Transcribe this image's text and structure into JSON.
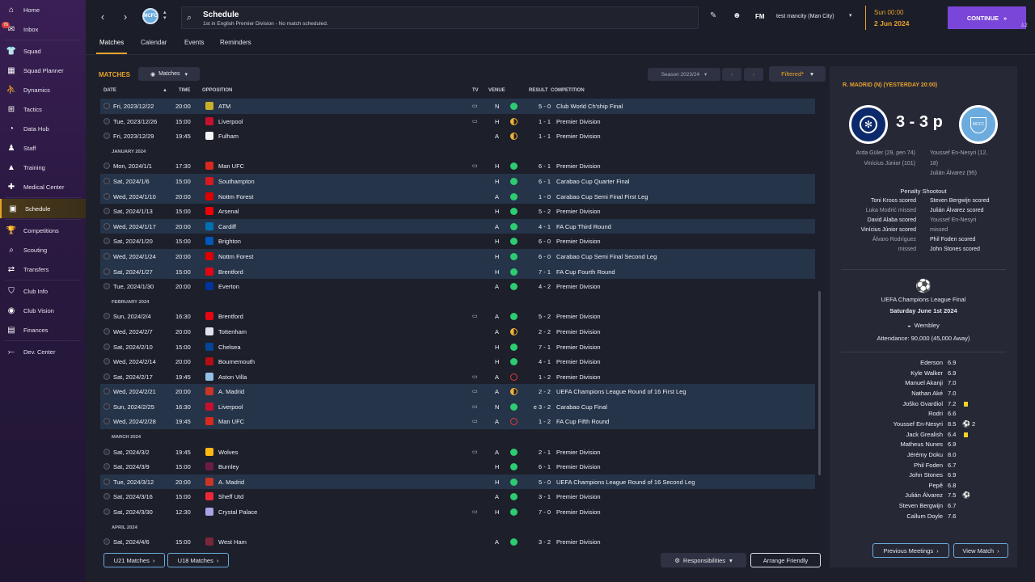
{
  "sidebar": {
    "inbox_badge": "76",
    "items": [
      {
        "label": "Home",
        "icon": "home-icon"
      },
      {
        "label": "Inbox",
        "icon": "inbox-icon"
      },
      {
        "label": "Squad",
        "icon": "shirt-icon"
      },
      {
        "label": "Squad Planner",
        "icon": "planner-icon"
      },
      {
        "label": "Dynamics",
        "icon": "dynamics-icon"
      },
      {
        "label": "Tactics",
        "icon": "tactics-icon"
      },
      {
        "label": "Data Hub",
        "icon": "datahub-icon"
      },
      {
        "label": "Staff",
        "icon": "staff-icon"
      },
      {
        "label": "Training",
        "icon": "training-icon"
      },
      {
        "label": "Medical Center",
        "icon": "medical-icon"
      },
      {
        "label": "Schedule",
        "icon": "calendar-icon"
      },
      {
        "label": "Competitions",
        "icon": "trophy-icon"
      },
      {
        "label": "Scouting",
        "icon": "scouting-icon"
      },
      {
        "label": "Transfers",
        "icon": "transfers-icon"
      },
      {
        "label": "Club Info",
        "icon": "shield-icon"
      },
      {
        "label": "Club Vision",
        "icon": "vision-icon"
      },
      {
        "label": "Finances",
        "icon": "finances-icon"
      },
      {
        "label": "Dev. Center",
        "icon": "dev-center-icon"
      }
    ]
  },
  "header": {
    "title": "Schedule",
    "subtitle": "1st in English Premier Division - No match scheduled.",
    "fm_label": "FM",
    "manager": "test mancity (Man City)",
    "time": "Sun 00:00",
    "date": "2 Jun 2024",
    "continue": "CONTINUE",
    "user_count": "2",
    "club_crest_text": "MCFC"
  },
  "tabs": [
    "Matches",
    "Calendar",
    "Events",
    "Reminders"
  ],
  "matches": {
    "title": "MATCHES",
    "view_dropdown": "Matches",
    "season": "Season 2023/24",
    "filter": "Filtered*",
    "columns": {
      "date": "DATE",
      "time": "TIME",
      "opposition": "OPPOSITION",
      "tv": "TV",
      "venue": "VENUE",
      "result": "RESULT",
      "competition": "COMPETITION"
    },
    "rows": [
      {
        "type": "match",
        "date": "Fri, 2023/12/22",
        "time": "20:00",
        "opp": "ATM",
        "tv": true,
        "venue": "N",
        "result": "5 - 0",
        "comp": "Club World Ch'ship Final",
        "outcome": "win",
        "crest": "#c8b02a",
        "hl": true
      },
      {
        "type": "match",
        "date": "Tue, 2023/12/26",
        "time": "15:00",
        "opp": "Liverpool",
        "tv": true,
        "venue": "H",
        "result": "1 - 1",
        "comp": "Premier Division",
        "outcome": "draw",
        "crest": "#c8102e",
        "hl": false
      },
      {
        "type": "match",
        "date": "Fri, 2023/12/29",
        "time": "19:45",
        "opp": "Fulham",
        "tv": false,
        "venue": "A",
        "result": "1 - 1",
        "comp": "Premier Division",
        "outcome": "draw",
        "crest": "#f4f4f4",
        "hl": false
      },
      {
        "type": "section",
        "label": "JANUARY 2024"
      },
      {
        "type": "match",
        "date": "Mon, 2024/1/1",
        "time": "17:30",
        "opp": "Man UFC",
        "tv": true,
        "venue": "H",
        "result": "6 - 1",
        "comp": "Premier Division",
        "outcome": "win",
        "crest": "#da291c",
        "hl": false
      },
      {
        "type": "match",
        "date": "Sat, 2024/1/6",
        "time": "15:00",
        "opp": "Southampton",
        "tv": false,
        "venue": "H",
        "result": "6 - 1",
        "comp": "Carabao Cup Quarter Final",
        "outcome": "win",
        "crest": "#d71920",
        "hl": true
      },
      {
        "type": "match",
        "date": "Wed, 2024/1/10",
        "time": "20:00",
        "opp": "Nottm Forest",
        "tv": false,
        "venue": "A",
        "result": "1 - 0",
        "comp": "Carabao Cup Semi Final First Leg",
        "outcome": "win",
        "crest": "#dd0000",
        "hl": true
      },
      {
        "type": "match",
        "date": "Sat, 2024/1/13",
        "time": "15:00",
        "opp": "Arsenal",
        "tv": false,
        "venue": "H",
        "result": "5 - 2",
        "comp": "Premier Division",
        "outcome": "win",
        "crest": "#ef0107",
        "hl": false
      },
      {
        "type": "match",
        "date": "Wed, 2024/1/17",
        "time": "20:00",
        "opp": "Cardiff",
        "tv": false,
        "venue": "A",
        "result": "4 - 1",
        "comp": "FA Cup Third Round",
        "outcome": "win",
        "crest": "#0070b5",
        "hl": true
      },
      {
        "type": "match",
        "date": "Sat, 2024/1/20",
        "time": "15:00",
        "opp": "Brighton",
        "tv": false,
        "venue": "H",
        "result": "6 - 0",
        "comp": "Premier Division",
        "outcome": "win",
        "crest": "#0057b8",
        "hl": false
      },
      {
        "type": "match",
        "date": "Wed, 2024/1/24",
        "time": "20:00",
        "opp": "Nottm Forest",
        "tv": false,
        "venue": "H",
        "result": "6 - 0",
        "comp": "Carabao Cup Semi Final Second Leg",
        "outcome": "win",
        "crest": "#dd0000",
        "hl": true
      },
      {
        "type": "match",
        "date": "Sat, 2024/1/27",
        "time": "15:00",
        "opp": "Brentford",
        "tv": false,
        "venue": "H",
        "result": "7 - 1",
        "comp": "FA Cup Fourth Round",
        "outcome": "win",
        "crest": "#e30613",
        "hl": true
      },
      {
        "type": "match",
        "date": "Tue, 2024/1/30",
        "time": "20:00",
        "opp": "Everton",
        "tv": false,
        "venue": "A",
        "result": "4 - 2",
        "comp": "Premier Division",
        "outcome": "win",
        "crest": "#003399",
        "hl": false
      },
      {
        "type": "section",
        "label": "FEBRUARY 2024"
      },
      {
        "type": "match",
        "date": "Sun, 2024/2/4",
        "time": "16:30",
        "opp": "Brentford",
        "tv": true,
        "venue": "A",
        "result": "5 - 2",
        "comp": "Premier Division",
        "outcome": "win",
        "crest": "#e30613",
        "hl": false
      },
      {
        "type": "match",
        "date": "Wed, 2024/2/7",
        "time": "20:00",
        "opp": "Tottenham",
        "tv": false,
        "venue": "A",
        "result": "2 - 2",
        "comp": "Premier Division",
        "outcome": "draw",
        "crest": "#dfe3ee",
        "hl": false
      },
      {
        "type": "match",
        "date": "Sat, 2024/2/10",
        "time": "15:00",
        "opp": "Chelsea",
        "tv": false,
        "venue": "H",
        "result": "7 - 1",
        "comp": "Premier Division",
        "outcome": "win",
        "crest": "#034694",
        "hl": false
      },
      {
        "type": "match",
        "date": "Wed, 2024/2/14",
        "time": "20:00",
        "opp": "Bournemouth",
        "tv": false,
        "venue": "H",
        "result": "4 - 1",
        "comp": "Premier Division",
        "outcome": "win",
        "crest": "#b50e12",
        "hl": false
      },
      {
        "type": "match",
        "date": "Sat, 2024/2/17",
        "time": "19:45",
        "opp": "Aston Villa",
        "tv": true,
        "venue": "A",
        "result": "1 - 2",
        "comp": "Premier Division",
        "outcome": "loss",
        "crest": "#95bfe5",
        "hl": false
      },
      {
        "type": "match",
        "date": "Wed, 2024/2/21",
        "time": "20:00",
        "opp": "A. Madrid",
        "tv": true,
        "venue": "A",
        "result": "2 - 2",
        "comp": "UEFA Champions League Round of 16 First Leg",
        "outcome": "draw",
        "crest": "#cb3524",
        "hl": true
      },
      {
        "type": "match",
        "date": "Sun, 2024/2/25",
        "time": "16:30",
        "opp": "Liverpool",
        "tv": true,
        "venue": "N",
        "result": "e 3 - 2",
        "comp": "Carabao Cup Final",
        "outcome": "win",
        "crest": "#c8102e",
        "hl": true
      },
      {
        "type": "match",
        "date": "Wed, 2024/2/28",
        "time": "19:45",
        "opp": "Man UFC",
        "tv": true,
        "venue": "A",
        "result": "1 - 2",
        "comp": "FA Cup Fifth Round",
        "outcome": "loss",
        "crest": "#da291c",
        "hl": true
      },
      {
        "type": "section",
        "label": "MARCH 2024"
      },
      {
        "type": "match",
        "date": "Sat, 2024/3/2",
        "time": "19:45",
        "opp": "Wolves",
        "tv": true,
        "venue": "A",
        "result": "2 - 1",
        "comp": "Premier Division",
        "outcome": "win",
        "crest": "#fdb913",
        "hl": false
      },
      {
        "type": "match",
        "date": "Sat, 2024/3/9",
        "time": "15:00",
        "opp": "Burnley",
        "tv": false,
        "venue": "H",
        "result": "6 - 1",
        "comp": "Premier Division",
        "outcome": "win",
        "crest": "#6c1d45",
        "hl": false
      },
      {
        "type": "match",
        "date": "Tue, 2024/3/12",
        "time": "20:00",
        "opp": "A. Madrid",
        "tv": false,
        "venue": "H",
        "result": "5 - 0",
        "comp": "UEFA Champions League Round of 16 Second Leg",
        "outcome": "win",
        "crest": "#cb3524",
        "hl": true
      },
      {
        "type": "match",
        "date": "Sat, 2024/3/16",
        "time": "15:00",
        "opp": "Sheff Utd",
        "tv": false,
        "venue": "A",
        "result": "3 - 1",
        "comp": "Premier Division",
        "outcome": "win",
        "crest": "#ee2737",
        "hl": false
      },
      {
        "type": "match",
        "date": "Sat, 2024/3/30",
        "time": "12:30",
        "opp": "Crystal Palace",
        "tv": true,
        "venue": "H",
        "result": "7 - 0",
        "comp": "Premier Division",
        "outcome": "win",
        "crest": "#a7a5e6",
        "hl": false
      },
      {
        "type": "section",
        "label": "APRIL 2024"
      },
      {
        "type": "match",
        "date": "Sat, 2024/4/6",
        "time": "15:00",
        "opp": "West Ham",
        "tv": false,
        "venue": "A",
        "result": "3 - 2",
        "comp": "Premier Division",
        "outcome": "win",
        "crest": "#7a263a",
        "hl": false
      }
    ],
    "footer": {
      "u21": "U21 Matches",
      "u18": "U18 Matches",
      "responsibilities": "Responsibilities",
      "arrange": "Arrange Friendly"
    }
  },
  "match_panel": {
    "title": "R. MADRID (N) (YESTERDAY 20:00)",
    "score": "3 - 3 p",
    "home_scorers": [
      "Arda Güler (29, pen 74)",
      "Vinícius Júnior (101)"
    ],
    "away_scorers": [
      "Youssef En-Nesyri (12,",
      "18)",
      "Julián Álvarez (95)"
    ],
    "penalty_title": "Penalty Shootout",
    "penalties_home": [
      [
        "Toni Kroos scored",
        "w"
      ],
      [
        "Luka Modrić missed",
        "m"
      ],
      [
        "David Alaba scored",
        "w"
      ],
      [
        "Vinícius Júnior scored",
        "w"
      ],
      [
        "Álvaro Rodríguez",
        "m"
      ],
      [
        "missed",
        "m"
      ]
    ],
    "penalties_away": [
      [
        "Steven Bergwijn scored",
        "w"
      ],
      [
        "Julián Álvarez scored",
        "w"
      ],
      [
        "Youssef En-Nesyri",
        "m"
      ],
      [
        "missed",
        "m"
      ],
      [
        "Phil Foden scored",
        "w"
      ],
      [
        "John Stones scored",
        "w"
      ]
    ],
    "competition": "UEFA Champions League Final",
    "date": "Saturday June 1st 2024",
    "venue": "Wembley",
    "attendance": "Attendance: 90,000 (45,000 Away)",
    "players": [
      {
        "name": "Ederson",
        "rating": "6.9",
        "mark": ""
      },
      {
        "name": "Kyle Walker",
        "rating": "6.9",
        "mark": ""
      },
      {
        "name": "Manuel Akanji",
        "rating": "7.0",
        "mark": ""
      },
      {
        "name": "Nathan Aké",
        "rating": "7.0",
        "mark": ""
      },
      {
        "name": "Joško Gvardiol",
        "rating": "7.2",
        "mark": "yellow"
      },
      {
        "name": "Rodri",
        "rating": "6.6",
        "mark": ""
      },
      {
        "name": "Youssef En-Nesyri",
        "rating": "8.5",
        "mark": "goal2"
      },
      {
        "name": "Jack Grealish",
        "rating": "6.4",
        "mark": "yellow"
      },
      {
        "name": "Matheus Nunes",
        "rating": "6.9",
        "mark": ""
      },
      {
        "name": "Jérémy Doku",
        "rating": "8.0",
        "mark": ""
      },
      {
        "name": "Phil Foden",
        "rating": "6.7",
        "mark": ""
      },
      {
        "name": "John Stones",
        "rating": "6.9",
        "mark": ""
      },
      {
        "name": "Pepê",
        "rating": "6.8",
        "mark": ""
      },
      {
        "name": "Julián Álvarez",
        "rating": "7.5",
        "mark": "goal"
      },
      {
        "name": "Steven Bergwijn",
        "rating": "6.7",
        "mark": ""
      },
      {
        "name": "Callum Doyle",
        "rating": "7.6",
        "mark": ""
      }
    ],
    "goal_count_label": "2",
    "buttons": {
      "meetings": "Previous Meetings",
      "view": "View Match"
    }
  },
  "colors": {
    "accent": "#e8a22a",
    "win": "#2ecc71",
    "draw": "#f0b23a",
    "loss": "#e23b3b",
    "highlight_row": "#263449",
    "continue": "#7a46d9"
  }
}
